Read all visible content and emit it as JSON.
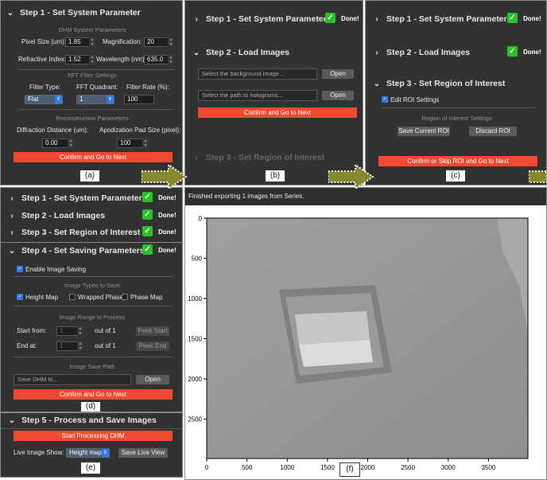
{
  "common": {
    "done": "Done!",
    "checkmark": "✓"
  },
  "panel_a": {
    "step1": "Step 1 - Set System Parameter",
    "dhm_params": "DHM System Parameters",
    "pixel_size_label": "Pixel Size (um):",
    "pixel_size": "1.85",
    "magnification_label": "Magnification:",
    "magnification": "20",
    "refractive_index_label": "Refractive Index:",
    "refractive_index": "1.52",
    "wavelength_label": "Wavelength (nm):",
    "wavelength": "635.0",
    "fft_settings": "FFT Filter Settings",
    "filter_type_label": "Filter Type:",
    "filter_type": "Flat",
    "fft_quadrant_label": "FFT Quadrant:",
    "fft_quadrant": "1",
    "filter_rate_label": "Filter Rate (%):",
    "filter_rate": "100",
    "recon_params": "Reconstruction Parameters",
    "diffraction_label": "Diffraction Distance (um):",
    "diffraction": "0.00",
    "apodization_label": "Apodization Pad Size (pixel):",
    "apodization": "100",
    "confirm": "Confirm and Go to Next",
    "caption": "(a)"
  },
  "panel_b": {
    "step1": "Step 1 - Set System Parameter",
    "step2": "Step 2 - Load Images",
    "bg_placeholder": "Select the background image...",
    "holo_placeholder": "Select the path to holograms...",
    "open": "Open",
    "confirm": "Confirm and Go to Next",
    "step3": "Step 3 - Set Region of Interest",
    "caption": "(b)"
  },
  "panel_c": {
    "step1": "Step 1 - Set System Parameter",
    "step2": "Step 2 - Load Images",
    "step3": "Step 3 - Set Region of Interest",
    "edit_roi": "Edit ROI Settings",
    "roi_settings": "Region of Interest Settings",
    "save_roi": "Save Current ROI",
    "discard_roi": "Discard ROI",
    "confirm": "Confirm or Skip ROI and Go to Next",
    "caption": "(c)"
  },
  "panel_d": {
    "step1": "Step 1 - Set System Parameter",
    "step2": "Step 2 - Load Images",
    "step3": "Step 3 - Set Region of Interest",
    "step4": "Step 4 - Set Saving Parameters",
    "enable_saving": "Enable Image Saving",
    "types_to_save": "Image Types to Save",
    "height_map": "Height Map",
    "wrapped_phase": "Wrapped Phase",
    "phase_map": "Phase Map",
    "range_to_process": "Image Range to Process",
    "start_from": "Start from:",
    "start_value": "1",
    "out_of_1": "out of 1",
    "peek_start": "Peek Start",
    "end_at": "End at:",
    "end_value": "1",
    "out_of_2": "out of 1",
    "peek_end": "Peek End",
    "save_path": "Image Save Path",
    "save_placeholder": "Save DHM to...",
    "open": "Open",
    "confirm": "Confirm and Go to Next",
    "caption": "(d)"
  },
  "panel_e": {
    "step5": "Step 5 - Process and Save Images",
    "start_processing": "Start Processing DHM",
    "live_label": "Live Image Show:",
    "live_select": "Height map",
    "save_live": "Save Live View",
    "caption": "(e)"
  },
  "panel_f": {
    "status": "Finished exporting 1 images from Series.",
    "caption": "(f)"
  },
  "chart_data": {
    "type": "heatmap",
    "x_ticks": [
      0,
      500,
      1000,
      1500,
      2000,
      2500,
      3000,
      3500
    ],
    "y_ticks": [
      0,
      500,
      1000,
      1500,
      2000,
      2500
    ],
    "xlim": [
      0,
      3990
    ],
    "ylim": [
      0,
      2990
    ]
  }
}
